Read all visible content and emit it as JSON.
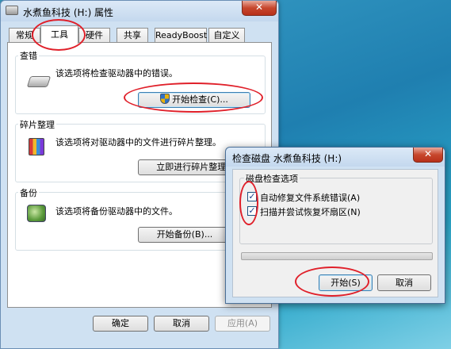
{
  "props_window": {
    "title": "水煮鱼科技 (H:) 属性",
    "close_glyph": "✕",
    "tabs": [
      {
        "label": "常规"
      },
      {
        "label": "工具"
      },
      {
        "label": "硬件"
      },
      {
        "label": "共享"
      },
      {
        "label": "ReadyBoost"
      },
      {
        "label": "自定义"
      }
    ],
    "active_tab": "工具",
    "groups": {
      "error_check": {
        "title": "查错",
        "description": "该选项将检查驱动器中的错误。",
        "button": "开始检查(C)..."
      },
      "defrag": {
        "title": "碎片整理",
        "description": "该选项将对驱动器中的文件进行碎片整理。",
        "button": "立即进行碎片整理(D)..."
      },
      "backup": {
        "title": "备份",
        "description": "该选项将备份驱动器中的文件。",
        "button": "开始备份(B)..."
      }
    },
    "footer": {
      "ok": "确定",
      "cancel": "取消",
      "apply": "应用(A)"
    }
  },
  "checkdisk_dialog": {
    "title": "检查磁盘 水煮鱼科技 (H:)",
    "close_glyph": "✕",
    "group_title": "磁盘检查选项",
    "options": [
      {
        "label": "自动修复文件系统错误(A)",
        "checked": true
      },
      {
        "label": "扫描并尝试恢复坏扇区(N)",
        "checked": true
      }
    ],
    "check_glyph": "✓",
    "start_button": "开始(S)",
    "cancel_button": "取消"
  },
  "colors": {
    "annotation": "#e0202a",
    "window_frame": "#cfe1f2",
    "close_button": "#c7472d"
  }
}
